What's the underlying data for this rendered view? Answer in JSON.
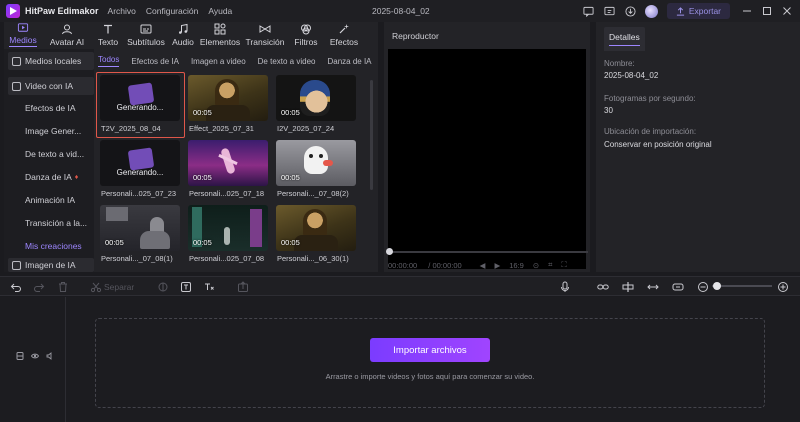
{
  "app": {
    "name": "HitPaw Edimakor",
    "menu": [
      "Archivo",
      "Configuración",
      "Ayuda"
    ],
    "project_title": "2025-08-04_02",
    "export_label": "Exportar"
  },
  "toolbar": [
    {
      "label": "Medios",
      "icon": "media-icon"
    },
    {
      "label": "Avatar AI",
      "icon": "avatar-icon"
    },
    {
      "label": "Texto",
      "icon": "text-icon"
    },
    {
      "label": "Subtítulos",
      "icon": "subtitles-icon"
    },
    {
      "label": "Audio",
      "icon": "audio-icon"
    },
    {
      "label": "Elementos",
      "icon": "elements-icon"
    },
    {
      "label": "Transición",
      "icon": "transition-icon"
    },
    {
      "label": "Filtros",
      "icon": "filters-icon"
    },
    {
      "label": "Efectos",
      "icon": "effects-icon"
    }
  ],
  "sidebar": [
    "Medios locales",
    "Video con IA",
    "Efectos de IA",
    "Image Gener...",
    "De texto a vid...",
    "Danza de IA",
    "Animación IA",
    "Transición a la...",
    "Mis creaciones",
    "Imagen de IA"
  ],
  "tabs": [
    "Todos",
    "Efectos de IA",
    "Imagen a video",
    "De texto a video",
    "Danza de IA"
  ],
  "grid": [
    {
      "label": "T2V_2025_08_04",
      "status": "Generando...",
      "kind": "generating"
    },
    {
      "label": "Effect_2025_07_31",
      "duration": "00:05",
      "kind": "monalisa"
    },
    {
      "label": "I2V_2025_07_24",
      "duration": "00:05",
      "kind": "pearl"
    },
    {
      "label": "Personali...025_07_23",
      "status": "Generando...",
      "kind": "generating"
    },
    {
      "label": "Personali...025_07_18",
      "duration": "00:05",
      "kind": "dancer"
    },
    {
      "label": "Personali..._07_08(2)",
      "duration": "00:05",
      "kind": "ghost"
    },
    {
      "label": "Personali..._07_08(1)",
      "duration": "00:05",
      "kind": "cat"
    },
    {
      "label": "Personali...025_07_08",
      "duration": "00:05",
      "kind": "city"
    },
    {
      "label": "Personali..._06_30(1)",
      "duration": "00:05",
      "kind": "monalisa"
    }
  ],
  "player": {
    "title": "Reproductor",
    "current_time": "00:00:00",
    "total_time": "00:00:00",
    "aspect": "16:9"
  },
  "details": {
    "tab": "Detalles",
    "fields": [
      {
        "label": "Nombre:",
        "value": "2025-08-04_02"
      },
      {
        "label": "Fotogramas por segundo:",
        "value": "30"
      },
      {
        "label": "Ubicación de importación:",
        "value": "Conservar en posición original"
      }
    ]
  },
  "timeline": {
    "split_label": "Separar",
    "import_button": "Importar archivos",
    "hint": "Arrastre o importe videos y fotos aquí para comenzar su video."
  },
  "colors": {
    "accent": "#9d86ff",
    "selection": "#e0574a",
    "import_gradient_start": "#7b3cff",
    "import_gradient_end": "#a044ff"
  }
}
